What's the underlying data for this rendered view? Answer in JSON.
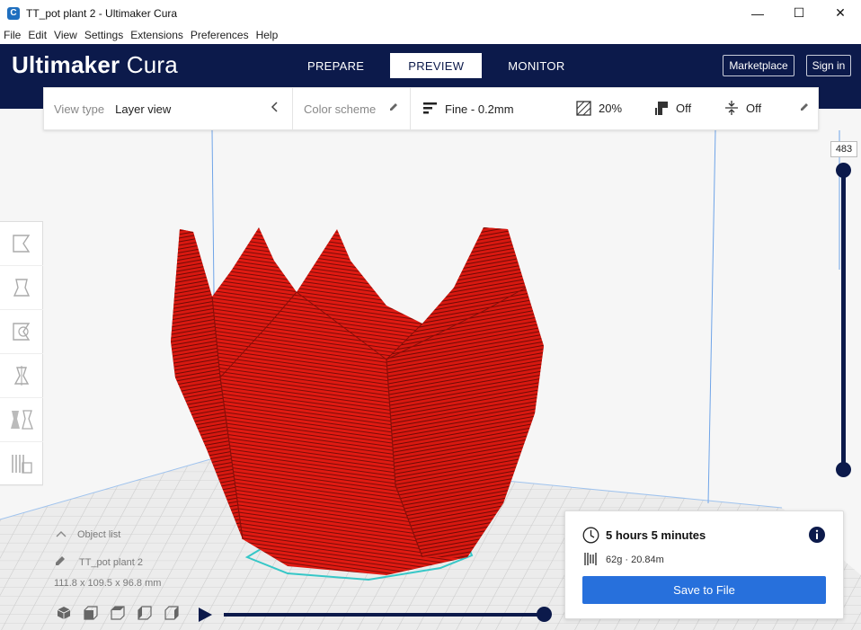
{
  "window": {
    "title": "TT_pot plant 2  - Ultimaker Cura",
    "minimize": "—",
    "maximize": "☐",
    "close": "✕"
  },
  "menu": [
    "File",
    "Edit",
    "View",
    "Settings",
    "Extensions",
    "Preferences",
    "Help"
  ],
  "header": {
    "brand_bold": "Ultimaker",
    "brand_light": " Cura",
    "tabs": [
      "PREPARE",
      "PREVIEW",
      "MONITOR"
    ],
    "active_tab": "PREVIEW",
    "marketplace_label": "Marketplace",
    "signin_label": "Sign in"
  },
  "settings_bar": {
    "view_type_label": "View type",
    "view_type_value": "Layer view",
    "color_scheme_label": "Color scheme",
    "profile": "Fine - 0.2mm",
    "infill": "20%",
    "support": "Off",
    "adhesion": "Off"
  },
  "tools": [
    "move-tool-icon",
    "scale-tool-icon",
    "rotate-tool-icon",
    "mirror-tool-icon",
    "per-model-settings-icon",
    "support-blocker-icon"
  ],
  "layer_slider": {
    "current_layer": "483",
    "position_top": 1.0,
    "position_bottom": 0.0
  },
  "object_list": {
    "header": "Object list",
    "object_name": "TT_pot plant 2",
    "dimensions": "111.8 x 109.5 x 96.8 mm"
  },
  "playback": {
    "progress": 1.0
  },
  "print_info": {
    "time": "5 hours 5 minutes",
    "material": "62g · 20.84m",
    "save_label": "Save to File"
  },
  "colors": {
    "navy": "#0c1a4b",
    "accent_blue": "#2770dc",
    "model_red": "#e01a12"
  }
}
